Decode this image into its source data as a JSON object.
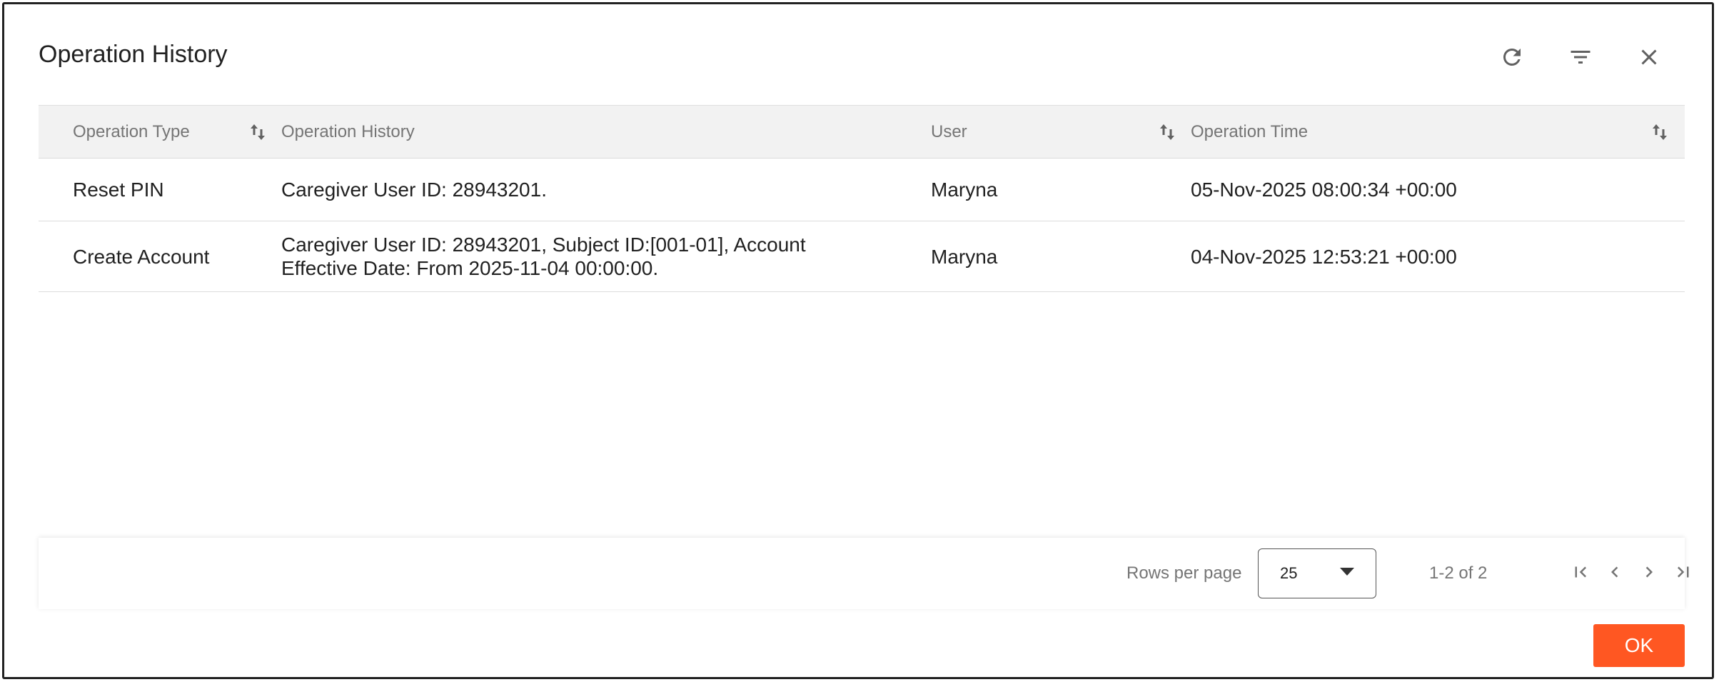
{
  "dialog": {
    "title": "Operation History",
    "header_icons": [
      "refresh-icon",
      "filter-icon",
      "close-icon"
    ]
  },
  "table": {
    "columns": [
      {
        "label": "Operation Type",
        "sortable": true
      },
      {
        "label": "Operation History",
        "sortable": false
      },
      {
        "label": "User",
        "sortable": true
      },
      {
        "label": "Operation Time",
        "sortable": true
      }
    ],
    "rows": [
      {
        "operation_type": "Reset PIN",
        "operation_history": "Caregiver User ID: 28943201.",
        "user": "Maryna",
        "operation_time": "05-Nov-2025 08:00:34 +00:00"
      },
      {
        "operation_type": "Create Account",
        "operation_history": "Caregiver User ID: 28943201, Subject ID:[001-01], Account Effective Date: From 2025-11-04 00:00:00.",
        "user": "Maryna",
        "operation_time": "04-Nov-2025 12:53:21 +00:00"
      }
    ]
  },
  "pagination": {
    "rows_per_page_label": "Rows per page",
    "rows_per_page_value": "25",
    "range_text": "1-2 of 2",
    "icons": [
      "first-page-icon",
      "previous-page-icon",
      "next-page-icon",
      "last-page-icon"
    ]
  },
  "actions": {
    "ok_label": "OK"
  },
  "colors": {
    "accent": "#ff5722",
    "header_bg": "#f2f2f2",
    "muted_text": "#757575",
    "text": "#212121"
  }
}
